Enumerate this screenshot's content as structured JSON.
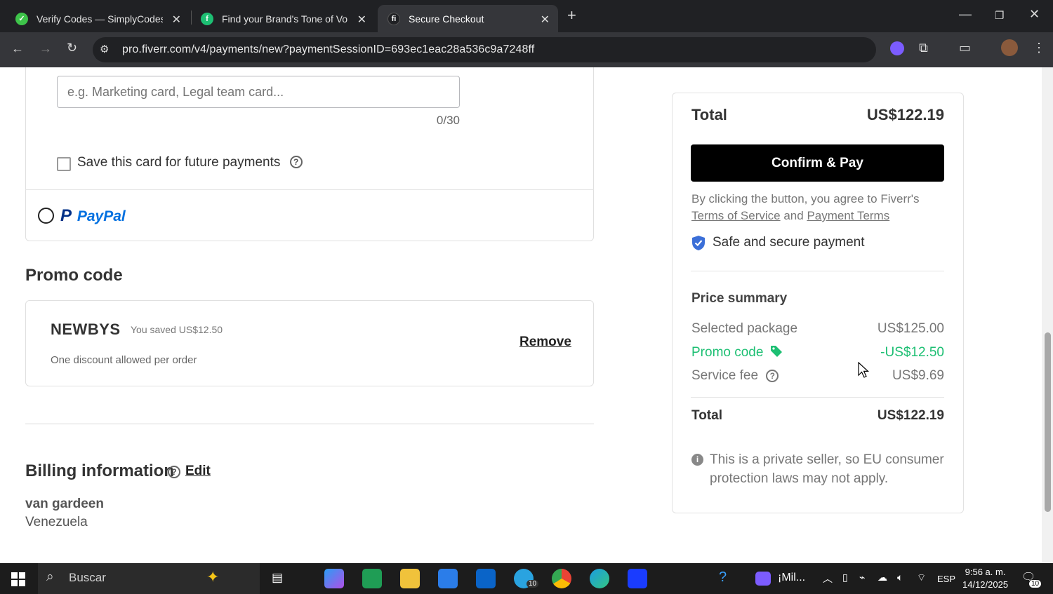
{
  "browser": {
    "tabs": [
      {
        "title": "Verify Codes — SimplyCodes",
        "favicon_color": "#3ec44a"
      },
      {
        "title": "Find your Brand's Tone of Voice",
        "favicon_color": "#1dbf73"
      },
      {
        "title": "Secure Checkout",
        "favicon_color": "#35363a"
      }
    ],
    "url": "pro.fiverr.com/v4/payments/new?paymentSessionID=693ec1eac28a536c9a7248ff"
  },
  "payment": {
    "card_name_placeholder": "e.g. Marketing card, Legal team card...",
    "char_counter": "0/30",
    "save_card_label": "Save this card for future payments",
    "paypal_logo_p": "P",
    "paypal_logo_text": "PayPal"
  },
  "promo": {
    "heading": "Promo code",
    "code": "NEWBYS",
    "saved": "You saved US$12.50",
    "note": "One discount allowed per order",
    "remove_label": "Remove"
  },
  "billing": {
    "heading": "Billing information",
    "edit_label": "Edit",
    "name": "van gardeen",
    "country": "Venezuela"
  },
  "summary": {
    "total_label": "Total",
    "total_value": "US$122.19",
    "confirm_label": "Confirm & Pay",
    "agree_text": "By clicking the button, you agree to Fiverr's",
    "terms_link": "Terms of Service",
    "and": "and",
    "payment_terms_link": "Payment Terms",
    "secure_text": "Safe and secure payment",
    "price_summary_heading": "Price summary",
    "rows": [
      {
        "label": "Selected package",
        "value": "US$125.00"
      },
      {
        "label": "Promo code",
        "value": "-US$12.50"
      },
      {
        "label": "Service fee",
        "value": "US$9.69"
      }
    ],
    "final_total_label": "Total",
    "final_total_value": "US$122.19",
    "info_text": "This is a private seller, so EU consumer protection laws may not apply."
  },
  "taskbar": {
    "search_placeholder": "Buscar",
    "media_label": "¡Mil...",
    "language": "ESP",
    "time": "9:56 a. m.",
    "date": "14/12/2025",
    "telegram_badge": "10",
    "notif_badge": "10"
  },
  "colors": {
    "fiverr_green": "#1dbf73",
    "confirm_bg": "#000000",
    "secure_blue": "#3b6fd8"
  }
}
